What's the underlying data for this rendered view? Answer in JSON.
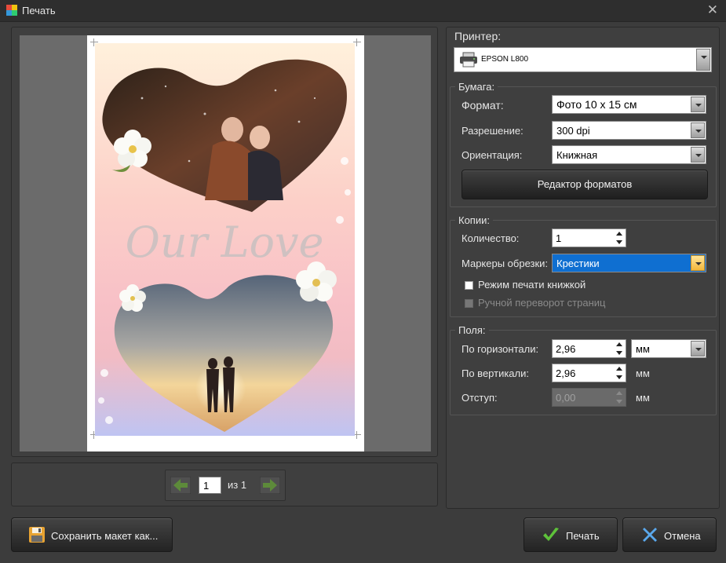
{
  "window": {
    "title": "Печать"
  },
  "preview": {
    "overlay_text": "Our Love",
    "page_number": "1",
    "page_of": "из 1"
  },
  "printer": {
    "section_label": "Принтер:",
    "selected": "EPSON L800"
  },
  "paper": {
    "group_label": "Бумага:",
    "format_label": "Формат:",
    "format_value": "Фото 10 x 15 см",
    "resolution_label": "Разрешение:",
    "resolution_value": "300 dpi",
    "orientation_label": "Ориентация:",
    "orientation_value": "Книжная",
    "format_editor_button": "Редактор форматов"
  },
  "copies": {
    "group_label": "Копии:",
    "quantity_label": "Количество:",
    "quantity_value": "1",
    "crop_marks_label": "Маркеры обрезки:",
    "crop_marks_value": "Крестики",
    "booklet_mode_label": "Режим печати книжкой",
    "booklet_mode_checked": false,
    "manual_flip_label": "Ручной переворот страниц",
    "manual_flip_checked": false
  },
  "margins": {
    "group_label": "Поля:",
    "horizontal_label": "По горизонтали:",
    "horizontal_value": "2,96",
    "unit_select_value": "мм",
    "vertical_label": "По вертикали:",
    "vertical_value": "2,96",
    "vertical_unit": "мм",
    "indent_label": "Отступ:",
    "indent_value": "0,00",
    "indent_unit": "мм"
  },
  "buttons": {
    "save_layout": "Сохранить макет как...",
    "print": "Печать",
    "cancel": "Отмена"
  },
  "colors": {
    "background": "#3c3c3c",
    "panel": "#3f3f3f",
    "selection": "#0f6fd1",
    "nav_arrow": "#5d8a3a"
  },
  "icons": [
    "app-icon",
    "printer-icon",
    "arrow-left-icon",
    "arrow-right-icon",
    "floppy-disk-icon",
    "checkmark-icon",
    "cross-icon",
    "close-icon"
  ]
}
